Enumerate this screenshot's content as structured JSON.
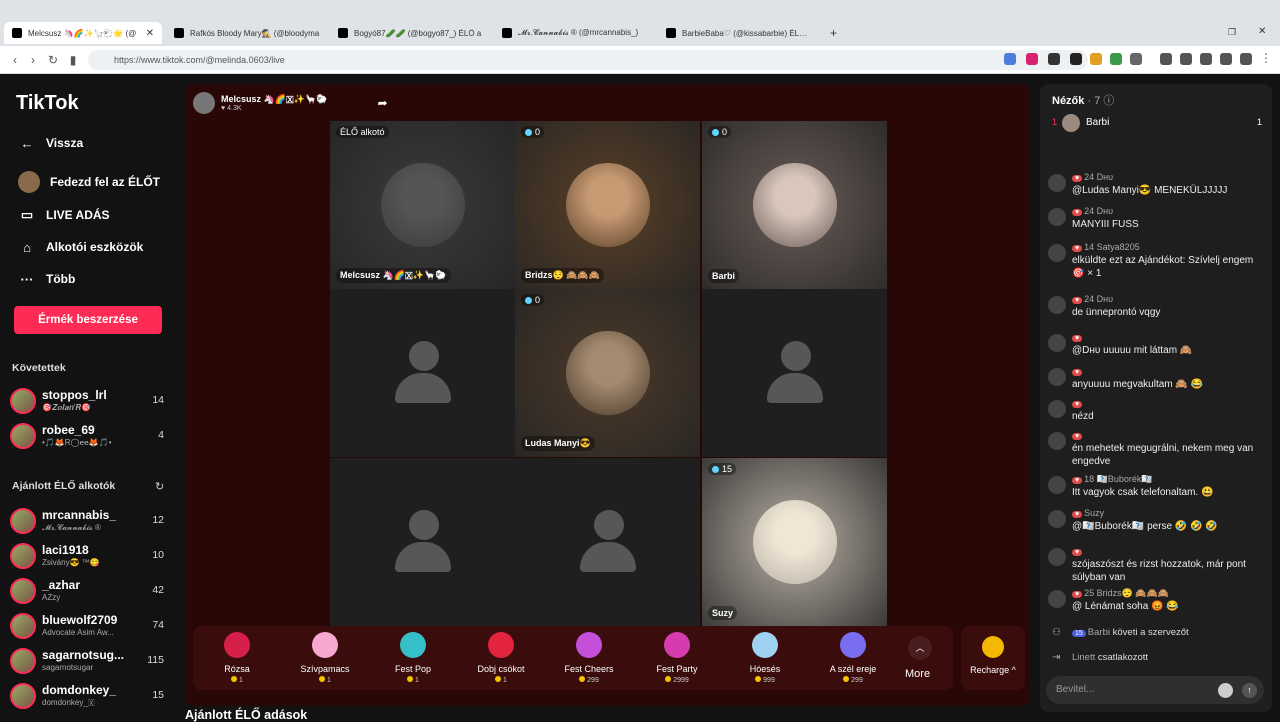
{
  "browser": {
    "tabs": [
      {
        "title": "Melcsusz 🦄🌈✨🦙🐑🌟 (@",
        "active": true
      },
      {
        "title": "Rafkós Bloody Mary🕵️ (@bloodyma"
      },
      {
        "title": "Bogyó87🥒🥒 (@bogyo87_) ÉLŐ a"
      },
      {
        "title": "𝓜𝓻.𝓒𝓪𝓷𝓷𝓪𝓫𝓲𝓼 ® (@mrcannabis_)"
      },
      {
        "title": "BarbieBaba♡ (@kissabarbie) ÉLŐ a"
      }
    ],
    "new_tab": "+",
    "url": "https://www.tiktok.com/@melinda.0603/live"
  },
  "sidebar": {
    "logo": "TikTok",
    "nav": [
      {
        "icon": "arrow-left-icon",
        "label": "Vissza"
      },
      {
        "icon": "avatar",
        "label": "Fedezd fel az ÉLŐT"
      },
      {
        "icon": "camera-icon",
        "label": "LIVE ADÁS"
      },
      {
        "icon": "tools-icon",
        "label": "Alkotói eszközök"
      },
      {
        "icon": "more-icon",
        "label": "Több"
      }
    ],
    "coins_button": "Érmék beszerzése",
    "following_title": "Követettek",
    "following": [
      {
        "name": "stoppos_lrl",
        "sub": "🎯𝒁𝒐𝒍𝒂𝒏'𝑹🎯",
        "count": "14"
      },
      {
        "name": "robee_69",
        "sub": "•🎵🦊R◯𝐞𝐞🦊🎵•",
        "count": "4"
      }
    ],
    "recommended_title": "Ajánlott ÉLŐ alkotók",
    "recommended": [
      {
        "name": "mrcannabis_",
        "sub": "𝓜𝓻.𝓒𝓪𝓷𝓷𝓪𝓫𝓲𝓼 ®",
        "count": "12"
      },
      {
        "name": "laci1918",
        "sub": "Zsivány😎 ™😋",
        "count": "10"
      },
      {
        "name": "_azhar",
        "sub": "AZzy",
        "count": "42"
      },
      {
        "name": "bluewolf2709",
        "sub": "Advocate Asim Aw...",
        "count": "74"
      },
      {
        "name": "sagarnotsug...",
        "sub": "sagarnotsugar",
        "count": "115"
      },
      {
        "name": "domdonkey_",
        "sub": "domdonkey_🇽",
        "count": "15"
      }
    ]
  },
  "stream": {
    "host": "Melcsusz 🦄🌈🇽✨🦙🐑",
    "host_likes": "♥ 4.3K",
    "cells": [
      {
        "label": "Melcsusz 🦄🌈🇽✨🦙🐑",
        "tag": "ÉLŐ alkotó",
        "count": "",
        "color": "#3b3b3b",
        "face": "#555"
      },
      {
        "label": "Bridzs😌 🙈🙈🙈",
        "count": "0",
        "color": "#5a4028",
        "face": "#c79a73"
      },
      {
        "label": "Barbi",
        "count": "0",
        "color": "#6a5d58",
        "face": "#d9c7bc"
      },
      {
        "label": "",
        "count": "",
        "empty": true
      },
      {
        "label": "Ludas Manyi😎",
        "count": "0",
        "color": "#4c3a2a",
        "face": "#a48a70"
      },
      {
        "label": "",
        "count": "",
        "empty": true
      },
      {
        "label": "",
        "count": "",
        "empty": true
      },
      {
        "label": "",
        "count": "",
        "empty": true
      },
      {
        "label": "Suzy",
        "count": "15",
        "color": "#b9b1a6",
        "face": "#efe6d5"
      }
    ],
    "gifts": [
      {
        "name": "Rózsa",
        "price": "1",
        "color": "#d6204a"
      },
      {
        "name": "Szívpamacs",
        "price": "1",
        "color": "#f6a8d1"
      },
      {
        "name": "Fest Pop",
        "price": "1",
        "color": "#35c0c8"
      },
      {
        "name": "Dobj csókot",
        "price": "1",
        "color": "#e2243f"
      },
      {
        "name": "Fest Cheers",
        "price": "299",
        "color": "#c44fd9"
      },
      {
        "name": "Fest Party",
        "price": "2999",
        "color": "#d63cb0"
      },
      {
        "name": "Hóesés",
        "price": "999",
        "color": "#9fd2f2"
      },
      {
        "name": "A szél ereje",
        "price": "299",
        "color": "#7a6ef0"
      }
    ],
    "more": "More",
    "recharge": "Recharge ^",
    "below_title": "Ajánlott ÉLŐ adások"
  },
  "chat": {
    "viewers_title": "Nézők",
    "viewers_count": "· 7",
    "top_viewer": {
      "rank": "1",
      "name": "Barbi",
      "score": "1"
    },
    "messages": [
      {
        "meta": "24 Dнυ",
        "text": "@Ludas Manyi😎 MENEKÜLJJJJJ"
      },
      {
        "meta": "24 Dнυ",
        "text": "MANYIII FUSS"
      },
      {
        "meta": "14 Satya8205",
        "text": "elküldte ezt az Ajándékot: Szívlelj engem 🎯 × 1"
      },
      {
        "meta": "24 Dнυ",
        "text": "de ünneprontó vqgy"
      },
      {
        "meta": "",
        "text": "@Dнυ uuuuu mit láttam 🙈"
      },
      {
        "meta": "",
        "text": "anyuuuu megvakultam 🙈 😂"
      },
      {
        "meta": "",
        "text": "nézd"
      },
      {
        "meta": "",
        "text": "én mehetek megugrálni, nekem meg van engedve"
      },
      {
        "meta": "18 🇽🇽Buborék🇽🇽",
        "text": "Itt vagyok csak telefonaltam. 😃"
      },
      {
        "meta": "Suzy",
        "text": "@🇽🇽Buborék🇽🇽 perse 🤣 🤣 🤣"
      },
      {
        "meta": "",
        "text": "szójaszószt és rizst hozzatok, már pont súlyban van"
      },
      {
        "meta": "25 Bridzs😌 🙈🙈🙈",
        "text": "@ Lénámat soha 😡 😂"
      }
    ],
    "follow_event": {
      "badge": "15",
      "name": "Barbi",
      "text": "követi a szervezőt"
    },
    "join_event": {
      "name": "Linett",
      "text": "csatlakozott"
    },
    "input_placeholder": "Bevitel..."
  }
}
